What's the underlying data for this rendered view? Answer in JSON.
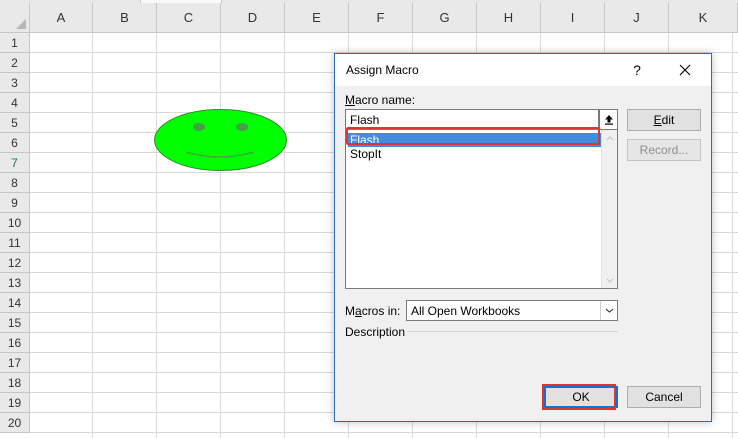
{
  "sheet": {
    "columns": [
      "A",
      "B",
      "C",
      "D",
      "E",
      "F",
      "G",
      "H",
      "I",
      "J",
      "K"
    ],
    "rows": [
      "1",
      "2",
      "3",
      "4",
      "5",
      "6",
      "7",
      "8",
      "9",
      "10",
      "11",
      "12",
      "13",
      "14",
      "15",
      "16",
      "17",
      "18",
      "19",
      "20"
    ],
    "selected_row": "7",
    "shape": {
      "fill": "#00ff00",
      "outline": "#2e8b2e",
      "feature_color": "#44a044"
    }
  },
  "dialog": {
    "title": "Assign Macro",
    "help_label": "?",
    "macro_name_label_prefix": "",
    "macro_name_label_accel": "M",
    "macro_name_label_rest": "acro name:",
    "macro_name_value": "Flash",
    "macros": [
      "Flash",
      "StopIt"
    ],
    "selected_macro": "Flash",
    "buttons": {
      "edit_accel": "E",
      "edit_rest": "dit",
      "record": "Record...",
      "ok": "OK",
      "cancel": "Cancel"
    },
    "macros_in_label_prefix": "M",
    "macros_in_label_accel": "a",
    "macros_in_label_rest": "cros in:",
    "macros_in_value": "All Open Workbooks",
    "description_label": "Description",
    "highlight_color": "#e03434",
    "selection_color": "#3d8ee0"
  }
}
